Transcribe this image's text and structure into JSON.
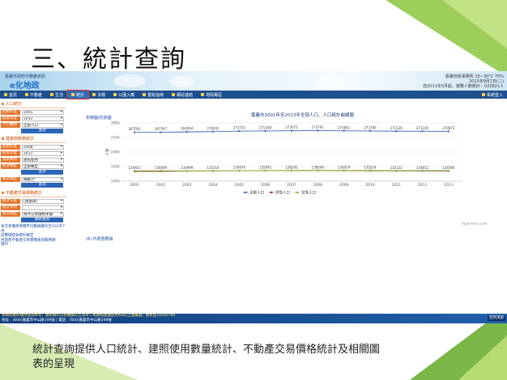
{
  "slide": {
    "title": "三、統計查詢",
    "caption": "統計查詢提供人口統計、建照使用數量統計、不動產交易價格統計及相關圖表的呈現"
  },
  "banner": {
    "site_small": "嘉義市政府不動產資訊",
    "site_name": "e化地政",
    "right_line1": "嘉義地政事務所 25~30°C  70%",
    "right_line2": "2015年9月1日(二)",
    "right_line3": "自2011年5月起，瀏覽人數統計：022821人"
  },
  "nav": {
    "items": [
      "首頁",
      "不動產",
      "生活",
      "統計",
      "法規",
      "公園入藏",
      "置點指南",
      "網站連結",
      "地政專區"
    ],
    "login": "系統登入"
  },
  "sidebar": {
    "sections": [
      {
        "title": "人口統計",
        "fields": [
          {
            "label": "起始年度",
            "value": "2001"
          },
          {
            "label": "結束年度",
            "value": "2013"
          },
          {
            "label": "人口類別",
            "value": "全部人口"
          }
        ],
        "button": "查詢"
      },
      {
        "title": "建築物數量統計",
        "fields": [
          {
            "label": "起始年度",
            "value": "2008"
          },
          {
            "label": "結束年度",
            "value": "2011"
          },
          {
            "label": "建築類別",
            "value": "建照使用"
          },
          {
            "label": "統計類型",
            "value": "全部類型"
          }
        ],
        "button": "查詢",
        "extra_field": {
          "label": "統計類型",
          "value": "棟數/戶"
        },
        "extra_button": "查詢"
      },
      {
        "title": "不動產交易價格統計",
        "fields": [
          {
            "label": "統計年度",
            "value": "(請選擇)"
          },
          {
            "label": "統計季別",
            "value": ""
          },
          {
            "label": "統計類型",
            "value": "每坪交易價格單價"
          }
        ],
        "button": "圖表查詢"
      }
    ],
    "notes": [
      "本交易價格單價平均數據顯示至101年7月",
      "前實價登錄資料確定",
      "內政部不動產交易實價查詢服務網",
      "資料"
    ]
  },
  "main": {
    "tab_label": "折線圖/柱狀圖",
    "source_link": "(6) 內政部數據",
    "credit": "Highcharts.com"
  },
  "chart_data": {
    "type": "line",
    "title": "嘉義市2001年至2013年全部人口、人口統計曲線圖",
    "xlabel": "",
    "ylabel": "人數",
    "y_ticks": [
      "300k",
      "250k",
      "200k",
      "150k",
      "100k"
    ],
    "ylim": [
      100000,
      300000
    ],
    "categories": [
      "2001",
      "2002",
      "2003",
      "2004",
      "2005",
      "2006",
      "2007",
      "2008",
      "2009",
      "2010",
      "2011",
      "2012",
      "2013"
    ],
    "series": [
      {
        "name": "全部人口",
        "color": "#3a67b3",
        "values": [
          267591,
          267597,
          269094,
          270041,
          271721,
          272390,
          273075,
          273791,
          272861,
          272390,
          271526,
          271220,
          270872
        ],
        "labels": [
          "267591",
          "267597",
          "269094",
          "270041",
          "271721",
          "272390",
          "273075",
          "273791",
          "272861",
          "272390",
          "271526",
          "271220",
          "270872"
        ]
      },
      {
        "name": "男性人口",
        "color": "#9a3a3a",
        "values": [
          134922,
          134699,
          134999,
          135314,
          135676,
          135941,
          136292,
          136549,
          136024,
          135524,
          135122,
          134812,
          134566
        ],
        "labels": [
          "134922",
          "134699",
          "134999",
          "135314",
          "135676",
          "135941",
          "136292",
          "136549",
          "136024",
          "135524",
          "135122",
          "134812",
          "134566"
        ]
      },
      {
        "name": "女性人口",
        "color": "#8ab83a",
        "values": [
          132669,
          132898,
          134095,
          134727,
          136045,
          136449,
          136783,
          137242,
          136837,
          136866,
          136404,
          136408,
          136306
        ]
      }
    ],
    "legend": "bottom"
  },
  "footer": {
    "line1": "本網站資料僅供查詢參考，實際資料以各機關公告為準 | 本網站建議使用IE8以上瀏覽器，解析度1024x768",
    "line2": "地址：(600)嘉義市中山路199號 | 電話：(600)嘉義市中山路199號",
    "button": "回到頂部"
  }
}
